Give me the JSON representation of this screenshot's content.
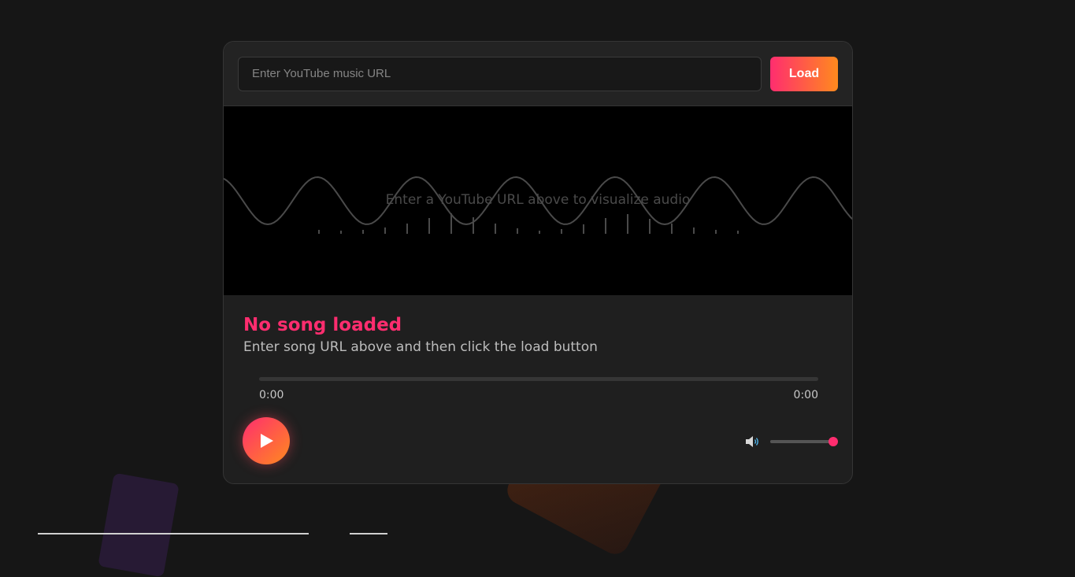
{
  "url_bar": {
    "input_value": "",
    "input_placeholder": "Enter YouTube music URL",
    "load_label": "Load"
  },
  "visualizer": {
    "hint": "Enter a YouTube URL above to visualize audio"
  },
  "song": {
    "title": "No song loaded",
    "subtitle": "Enter song URL above and then click the load button"
  },
  "player": {
    "current_time": "0:00",
    "duration": "0:00",
    "progress": 0,
    "volume": 1.0,
    "play_icon": "play-icon",
    "volume_icon": "speaker-icon"
  },
  "colors": {
    "accent_pink": "#ff2d6f",
    "accent_orange": "#ff8a1e",
    "background": "#161616",
    "card": "#1f1f1f"
  }
}
